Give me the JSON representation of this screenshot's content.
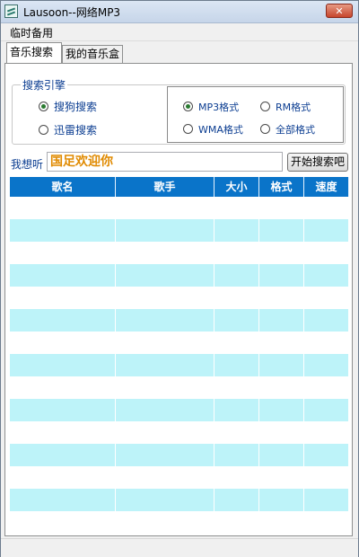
{
  "window": {
    "title": "Lausoon--网络MP3",
    "close_label": "✕"
  },
  "menu": {
    "items": [
      "临时备用"
    ]
  },
  "tabs": [
    {
      "label": "音乐搜索",
      "active": true
    },
    {
      "label": "我的音乐盒",
      "active": false
    }
  ],
  "engine": {
    "legend": "搜索引擎",
    "options": [
      {
        "label": "搜狗搜索",
        "checked": true
      },
      {
        "label": "迅雷搜索",
        "checked": false
      }
    ]
  },
  "formats": {
    "options": [
      {
        "label": "MP3格式",
        "checked": true
      },
      {
        "label": "RM格式",
        "checked": false
      },
      {
        "label": "WMA格式",
        "checked": false
      },
      {
        "label": "全部格式",
        "checked": false
      }
    ]
  },
  "search": {
    "label": "我想听",
    "value": "国足欢迎你",
    "button_label": "开始搜索吧"
  },
  "table": {
    "columns": [
      "歌名",
      "歌手",
      "大小",
      "格式",
      "速度"
    ],
    "row_count": 15
  },
  "colors": {
    "header_bg": "#0a74c9",
    "alt_row": "#bdf3f9",
    "input_text": "#e08a00",
    "label_text": "#0b3d91"
  }
}
